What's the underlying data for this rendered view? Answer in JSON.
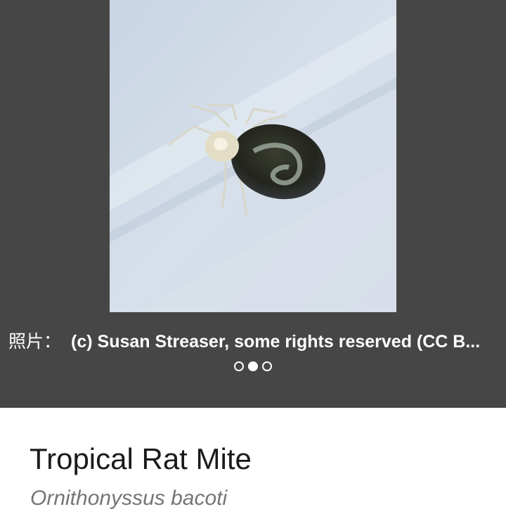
{
  "gallery": {
    "photo": {
      "subject": "mite on pale blue-white surface"
    },
    "attribution": {
      "prefix": "照片：",
      "text": "(c) Susan Streaser, some rights reserved (CC B..."
    },
    "pager": {
      "count": 3,
      "active_index": 1
    },
    "colors": {
      "background": "#464646",
      "dot": "#ffffff"
    }
  },
  "species": {
    "common_name": "Tropical Rat Mite",
    "scientific_name": "Ornithonyssus bacoti"
  }
}
